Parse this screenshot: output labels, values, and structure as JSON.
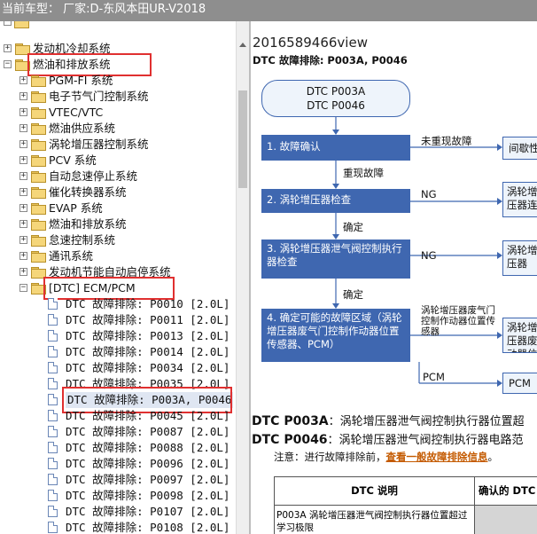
{
  "window": {
    "title": "当前车型：  厂家:D-东风本田UR-V2018"
  },
  "tree": {
    "items": [
      {
        "label": "发动机冷却系统",
        "expander": "+",
        "kind": "folder"
      },
      {
        "label": "燃油和排放系统",
        "expander": "−",
        "kind": "folder"
      },
      {
        "label": "PGM-FI 系统",
        "expander": "+",
        "kind": "folder"
      },
      {
        "label": "电子节气门控制系统",
        "expander": "+",
        "kind": "folder"
      },
      {
        "label": "VTEC/VTC",
        "expander": "+",
        "kind": "folder"
      },
      {
        "label": "燃油供应系统",
        "expander": "+",
        "kind": "folder"
      },
      {
        "label": "涡轮增压器控制系统",
        "expander": "+",
        "kind": "folder"
      },
      {
        "label": "PCV 系统",
        "expander": "+",
        "kind": "folder"
      },
      {
        "label": "自动怠速停止系统",
        "expander": "+",
        "kind": "folder"
      },
      {
        "label": "催化转换器系统",
        "expander": "+",
        "kind": "folder"
      },
      {
        "label": "EVAP 系统",
        "expander": "+",
        "kind": "folder"
      },
      {
        "label": "燃油和排放系统",
        "expander": "+",
        "kind": "folder"
      },
      {
        "label": "怠速控制系统",
        "expander": "+",
        "kind": "folder"
      },
      {
        "label": "通讯系统",
        "expander": "+",
        "kind": "folder"
      },
      {
        "label": "发动机节能自动启停系统",
        "expander": "+",
        "kind": "folder"
      },
      {
        "label": "[DTC] ECM/PCM",
        "expander": "−",
        "kind": "folder"
      },
      {
        "label": "DTC 故障排除: P0010 [2.0L]",
        "kind": "doc"
      },
      {
        "label": "DTC 故障排除: P0011 [2.0L]",
        "kind": "doc"
      },
      {
        "label": "DTC 故障排除: P0013 [2.0L]",
        "kind": "doc"
      },
      {
        "label": "DTC 故障排除: P0014 [2.0L]",
        "kind": "doc"
      },
      {
        "label": "DTC 故障排除: P0034 [2.0L]",
        "kind": "doc"
      },
      {
        "label": "DTC 故障排除: P0035 [2.0L]",
        "kind": "doc"
      },
      {
        "label": "DTC 故障排除: P003A, P0046",
        "kind": "doc",
        "selected": true
      },
      {
        "label": "DTC 故障排除: P0045 [2.0L]",
        "kind": "doc"
      },
      {
        "label": "DTC 故障排除: P0087 [2.0L]",
        "kind": "doc"
      },
      {
        "label": "DTC 故障排除: P0088 [2.0L]",
        "kind": "doc"
      },
      {
        "label": "DTC 故障排除: P0096 [2.0L]",
        "kind": "doc"
      },
      {
        "label": "DTC 故障排除: P0097 [2.0L]",
        "kind": "doc"
      },
      {
        "label": "DTC 故障排除: P0098 [2.0L]",
        "kind": "doc"
      },
      {
        "label": "DTC 故障排除: P0107 [2.0L]",
        "kind": "doc"
      },
      {
        "label": "DTC 故障排除: P0108 [2.0L]",
        "kind": "doc"
      }
    ]
  },
  "content": {
    "view_title": "2016589466view",
    "subtitle": "DTC 故障排除: P003A, P0046",
    "flow": {
      "start_line1": "DTC P003A",
      "start_line2": "DTC P0046",
      "step1": "1.  故障确认",
      "step1_no": "未重现故障",
      "step1_no_target": "间歇性",
      "step1_yes": "重现故障",
      "step2": "2.  涡轮增压器检查",
      "step2_ng": "NG",
      "step2_target": "涡轮增压器连",
      "confirm1": "确定",
      "step3": "3.  涡轮增压器泄气阀控制执行器检查",
      "step3_ng": "NG",
      "step3_target": "涡轮增压器",
      "confirm2": "确定",
      "step4": "4.  确定可能的故障区域（涡轮增压器废气门控制作动器位置传感器、PCM）",
      "step4_branch": "涡轮增压器废气门控制作动器位置传感器",
      "step4_target": "涡轮增压器废动器位",
      "pcm_branch": "PCM",
      "pcm_target": "PCM"
    },
    "heading1_code": "DTC P003A",
    "heading1_text": "：涡轮增压器泄气阀控制执行器位置超",
    "heading2_code": "DTC P0046",
    "heading2_text": "：涡轮增压器泄气阀控制执行器电路范",
    "note_prefix": "注意：进行故障排除前，",
    "note_link": "查看一般故障排除信息",
    "note_suffix": "。",
    "table": {
      "col1": "DTC 说明",
      "col2": "确认的 DTC",
      "row1_desc": "P003A 涡轮增压器泄气阀控制执行器位置超过学习极限"
    }
  }
}
